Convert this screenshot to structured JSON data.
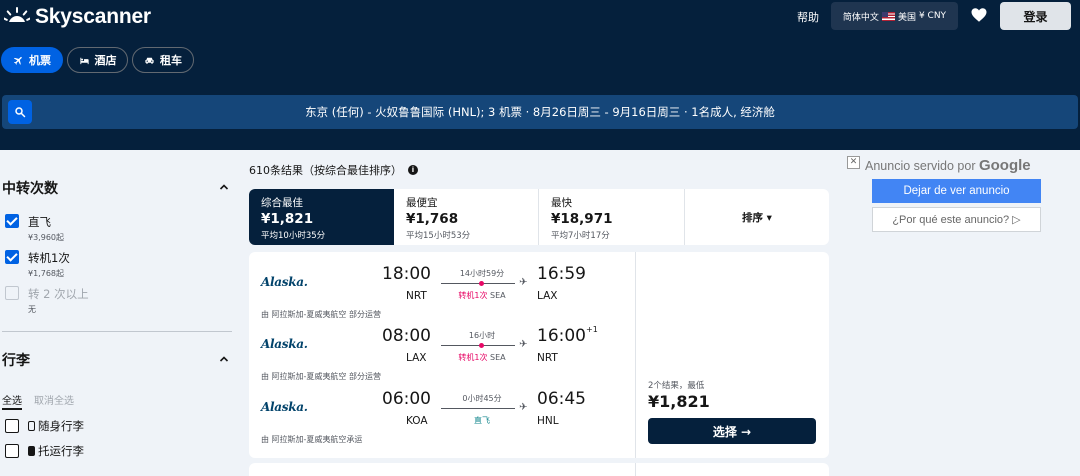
{
  "header": {
    "brand": "Skyscanner",
    "help": "帮助",
    "locale": {
      "language": "简体中文",
      "country": "美国",
      "currency": "¥ CNY"
    },
    "login": "登录"
  },
  "product_tabs": [
    {
      "label": "机票",
      "icon": "plane-icon",
      "active": true
    },
    {
      "label": "酒店",
      "icon": "bed-icon",
      "active": false
    },
    {
      "label": "租车",
      "icon": "car-icon",
      "active": false
    }
  ],
  "search": {
    "summary": "东京 (任何) - 火奴鲁鲁国际 (HNL); 3 机票 · 8月26日周三 - 9月16日周三 · 1名成人, 经济舱"
  },
  "filters": {
    "stops": {
      "title": "中转次数",
      "options": [
        {
          "label": "直飞",
          "sub": "¥3,960起",
          "checked": true,
          "disabled": false
        },
        {
          "label": "转机1次",
          "sub": "¥1,768起",
          "checked": true,
          "disabled": false
        },
        {
          "label": "转 2 次以上",
          "sub": "无",
          "checked": false,
          "disabled": true
        }
      ]
    },
    "baggage": {
      "title": "行李",
      "select_all": "全选",
      "deselect_all": "取消全选",
      "options": [
        {
          "label": "随身行李",
          "checked": false
        },
        {
          "label": "托运行李",
          "checked": false
        }
      ]
    }
  },
  "results": {
    "count_text": "610条结果（按综合最佳排序）",
    "info_symbol": "i",
    "sort_tabs": [
      {
        "label": "综合最佳",
        "price": "¥1,821",
        "sub": "平均10小时35分",
        "active": true
      },
      {
        "label": "最便宜",
        "price": "¥1,768",
        "sub": "平均15小时53分",
        "active": false
      },
      {
        "label": "最快",
        "price": "¥18,971",
        "sub": "平均7小时17分",
        "active": false
      }
    ],
    "sort_label": "排序 ▾",
    "cards": [
      {
        "legs": [
          {
            "airline": "Alaska.",
            "dep_time": "18:00",
            "dep_airport": "NRT",
            "arr_time": "16:59",
            "arr_day": "",
            "arr_airport": "LAX",
            "duration": "14小时59分",
            "stops": "转机1次",
            "via": "SEA",
            "direct": false,
            "operated_by": "由 阿拉斯加-夏威夷航空 部分运营"
          },
          {
            "airline": "Alaska.",
            "dep_time": "08:00",
            "dep_airport": "LAX",
            "arr_time": "16:00",
            "arr_day": "+1",
            "arr_airport": "NRT",
            "duration": "16小时",
            "stops": "转机1次",
            "via": "SEA",
            "direct": false,
            "operated_by": "由 阿拉斯加-夏威夷航空 部分运营"
          },
          {
            "airline": "Alaska.",
            "dep_time": "06:00",
            "dep_airport": "KOA",
            "arr_time": "06:45",
            "arr_day": "",
            "arr_airport": "HNL",
            "duration": "0小时45分",
            "stops": "直飞",
            "via": "",
            "direct": true,
            "operated_by": "由 阿拉斯加-夏威夷航空承运"
          }
        ],
        "price_note": "2个结果，最低",
        "price": "¥1,821",
        "select_label": "选择 →"
      }
    ]
  },
  "ad": {
    "close_symbol": "✕",
    "served_by": "Anuncio servido por",
    "served_brand": "Google",
    "stop_seeing": "Dejar de ver anuncio",
    "why": "¿Por qué este anuncio? ▷"
  },
  "colors": {
    "header_bg": "#05203c",
    "search_bg": "#154679",
    "accent_blue": "#0062e3",
    "stop_pink": "#e70866",
    "direct_teal": "#0c838a",
    "page_bg": "#eff3f8"
  }
}
